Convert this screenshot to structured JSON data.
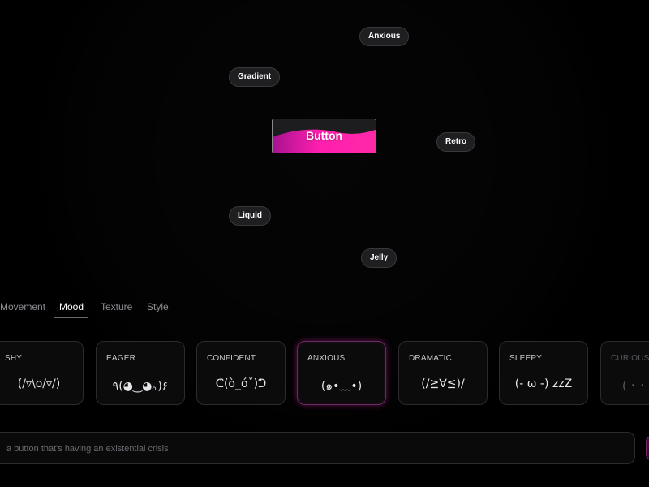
{
  "colors": {
    "accent": "#ff1fae",
    "accent_dark": "#a8128f",
    "background": "#000000",
    "chip_bg": "#1f1f21",
    "card_border": "#2b2b2e"
  },
  "preview": {
    "button_label": "Button"
  },
  "chips": {
    "anxious": "Anxious",
    "gradient": "Gradient",
    "retro": "Retro",
    "liquid": "Liquid",
    "jelly": "Jelly"
  },
  "tabs": [
    {
      "label": "Movement"
    },
    {
      "label": "Mood"
    },
    {
      "label": "Texture"
    },
    {
      "label": "Style"
    }
  ],
  "active_tab": "Mood",
  "moods": [
    {
      "title": "SHY",
      "face": "(/▿\\o/▿/)"
    },
    {
      "title": "EAGER",
      "face": "٩(◕‿◕｡)۶"
    },
    {
      "title": "CONFIDENT",
      "face": "ᕦ(ò_óˇ)ᕤ"
    },
    {
      "title": "ANXIOUS",
      "face": "(๑•﹏•)"
    },
    {
      "title": "DRAMATIC",
      "face": "(/≧∀≦)/"
    },
    {
      "title": "SLEEPY",
      "face": "(- ω -) zzZ"
    },
    {
      "title": "CURIOUS",
      "face": "( ･ ･"
    }
  ],
  "selected_mood": "ANXIOUS",
  "prompt": {
    "placeholder": "a button that's having an existential crisis",
    "value": ""
  }
}
